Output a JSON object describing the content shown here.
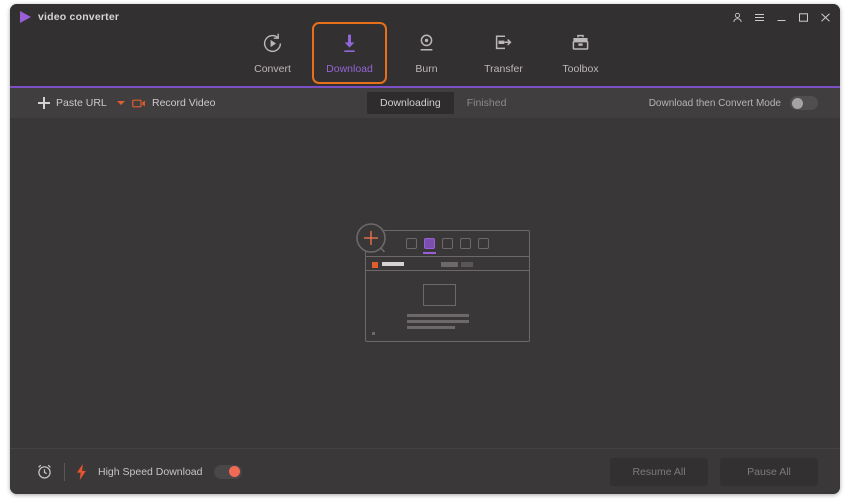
{
  "window": {
    "title": "video converter",
    "logo_icon": "play-triangle-logo",
    "controls": [
      {
        "name": "account-icon",
        "glyph": "user"
      },
      {
        "name": "menu-icon",
        "glyph": "hamburger"
      },
      {
        "name": "minimize-icon",
        "glyph": "minimize"
      },
      {
        "name": "maximize-icon",
        "glyph": "maximize"
      },
      {
        "name": "close-icon",
        "glyph": "close"
      }
    ]
  },
  "nav": {
    "active": "Download",
    "accent_color": "#e8701a",
    "active_color": "#9166d6",
    "items": [
      {
        "label": "Convert",
        "icon": "convert-icon"
      },
      {
        "label": "Download",
        "icon": "download-icon"
      },
      {
        "label": "Burn",
        "icon": "burn-icon"
      },
      {
        "label": "Transfer",
        "icon": "transfer-icon"
      },
      {
        "label": "Toolbox",
        "icon": "toolbox-icon"
      }
    ]
  },
  "toolbar": {
    "paste_url_label": "Paste URL",
    "paste_url_icon": "plus-icon",
    "paste_url_caret": "chevron-down-icon",
    "record_video_label": "Record Video",
    "record_video_icon": "camcorder-icon",
    "tabs": [
      {
        "label": "Downloading",
        "selected": true
      },
      {
        "label": "Finished",
        "selected": false
      }
    ],
    "convert_mode_label": "Download then Convert Mode",
    "convert_mode_on": false
  },
  "canvas": {
    "illustration": "browser-window-placeholder",
    "magnifier_icon": "magnifier-crosshair-icon",
    "highlight_color": "#9a5fd8",
    "crosshair_color": "#e8734a"
  },
  "footer": {
    "schedule_icon": "alarm-clock-icon",
    "speed_icon": "lightning-bolt-icon",
    "high_speed_label": "High Speed Download",
    "high_speed_on": true,
    "resume_all_label": "Resume All",
    "pause_all_label": "Pause All"
  }
}
